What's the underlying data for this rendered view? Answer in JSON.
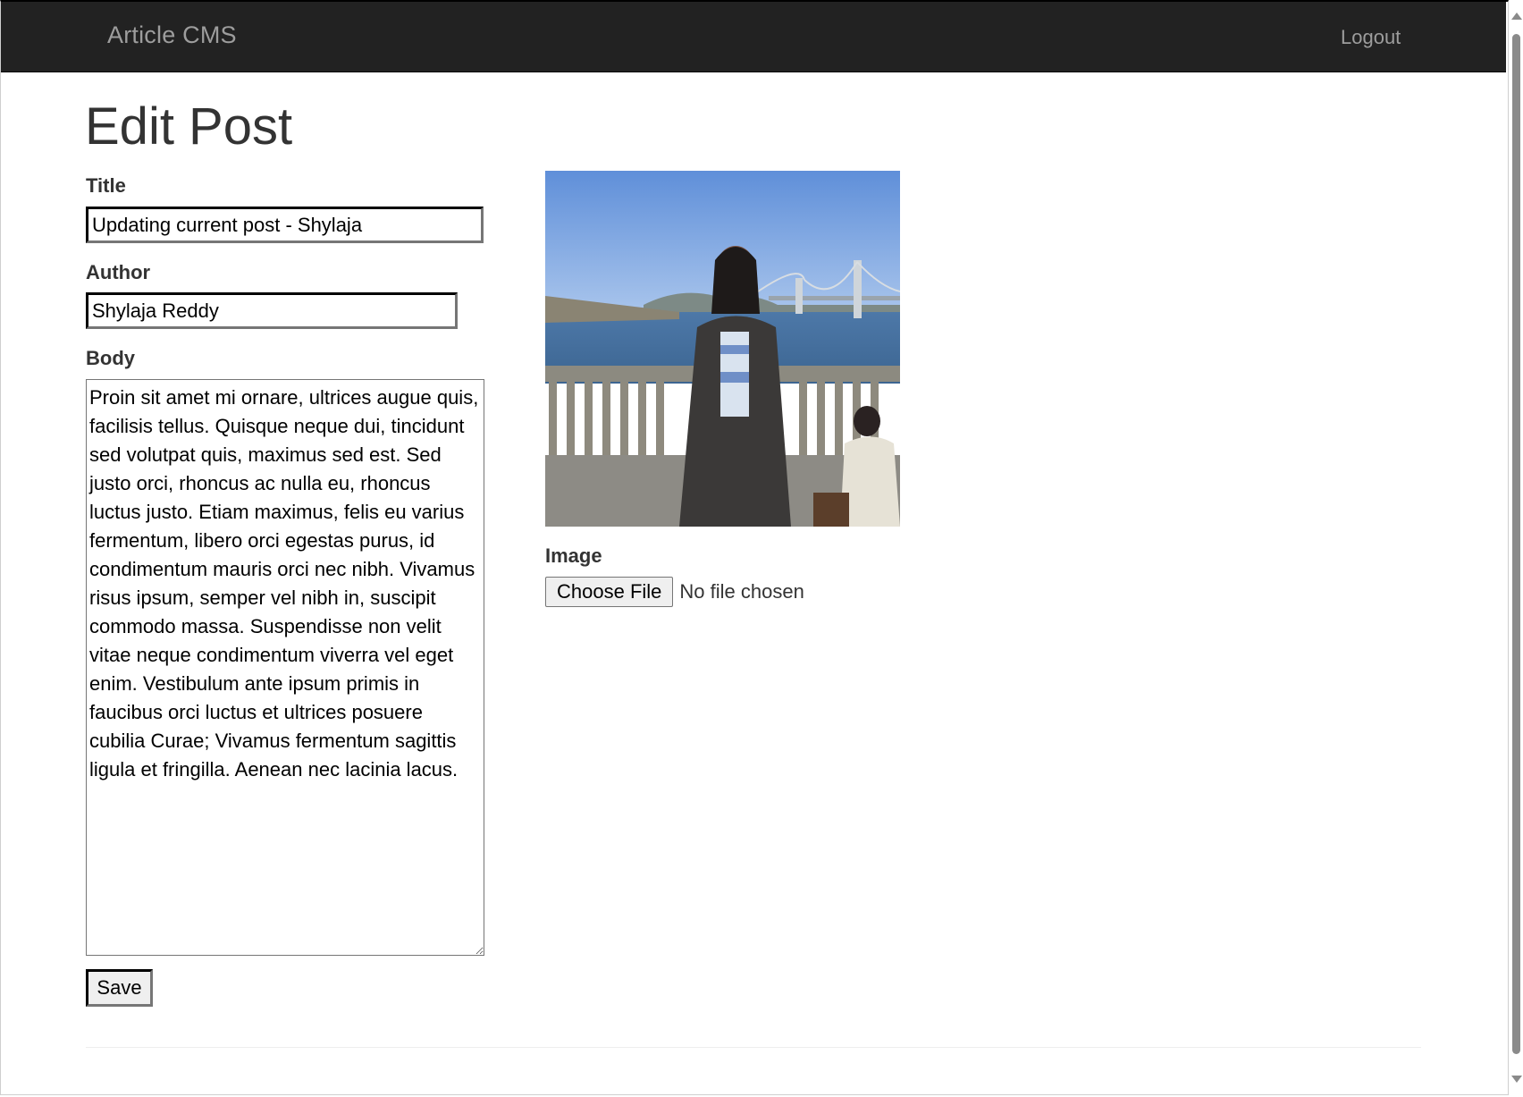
{
  "navbar": {
    "brand": "Article CMS",
    "logout_label": "Logout"
  },
  "page": {
    "heading": "Edit Post"
  },
  "form": {
    "title_label": "Title",
    "title_value": "Updating current post - Shylaja",
    "author_label": "Author",
    "author_value": "Shylaja Reddy",
    "body_label": "Body",
    "body_value": "Proin sit amet mi ornare, ultrices augue quis, facilisis tellus. Quisque neque dui, tincidunt sed volutpat quis, maximus sed est. Sed justo orci, rhoncus ac nulla eu, rhoncus luctus justo. Etiam maximus, felis eu varius fermentum, libero orci egestas purus, id condimentum mauris orci nec nibh. Vivamus risus ipsum, semper vel nibh in, suscipit commodo massa. Suspendisse non velit vitae neque condimentum viverra vel eget enim. Vestibulum ante ipsum primis in faucibus orci luctus et ultrices posuere cubilia Curae; Vivamus fermentum sagittis ligula et fringilla. Aenean nec lacinia lacus.",
    "save_label": "Save",
    "image_label": "Image",
    "choose_file_label": "Choose File",
    "no_file_text": "No file chosen"
  },
  "colors": {
    "navbar_bg": "#222222",
    "navbar_text": "#9d9d9d",
    "text": "#333333"
  }
}
